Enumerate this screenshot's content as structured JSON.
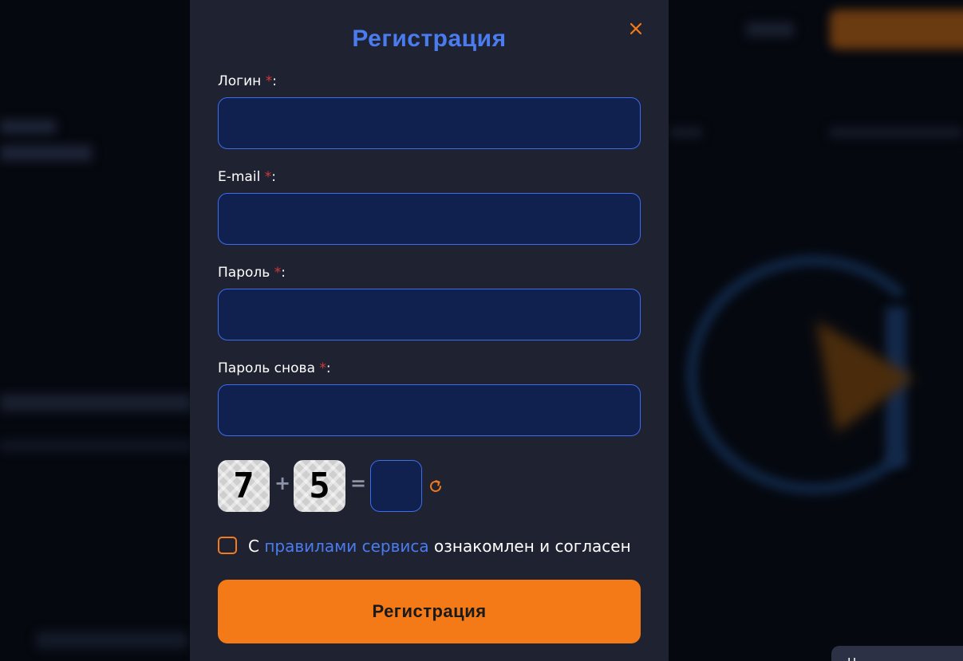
{
  "chat_tab": {
    "label": "Н"
  },
  "modal": {
    "title": "Регистрация",
    "fields": [
      {
        "label": "Логин",
        "required_mark": "*",
        "suffix": ":",
        "value": ""
      },
      {
        "label": "E-mail",
        "required_mark": "*",
        "suffix": ":",
        "value": ""
      },
      {
        "label": "Пароль",
        "required_mark": "*",
        "suffix": ":",
        "value": ""
      },
      {
        "label": "Пароль снова",
        "required_mark": "*",
        "suffix": ":",
        "value": ""
      }
    ],
    "captcha": {
      "first_digit": "7",
      "operator": "+",
      "second_digit": "5",
      "equals": "=",
      "answer": ""
    },
    "agreement": {
      "prefix": "С",
      "link_text": "правилами сервиса",
      "suffix": "ознакомлен и согласен",
      "checked": false
    },
    "submit_label": "Регистрация"
  },
  "colors": {
    "accent_blue": "#4a7cf0",
    "accent_orange": "#f47a17",
    "required_red": "#d23a3a",
    "modal_bg": "#1f2230",
    "input_bg": "#102150"
  },
  "icons": {
    "close": "close-icon",
    "refresh": "refresh-icon"
  }
}
